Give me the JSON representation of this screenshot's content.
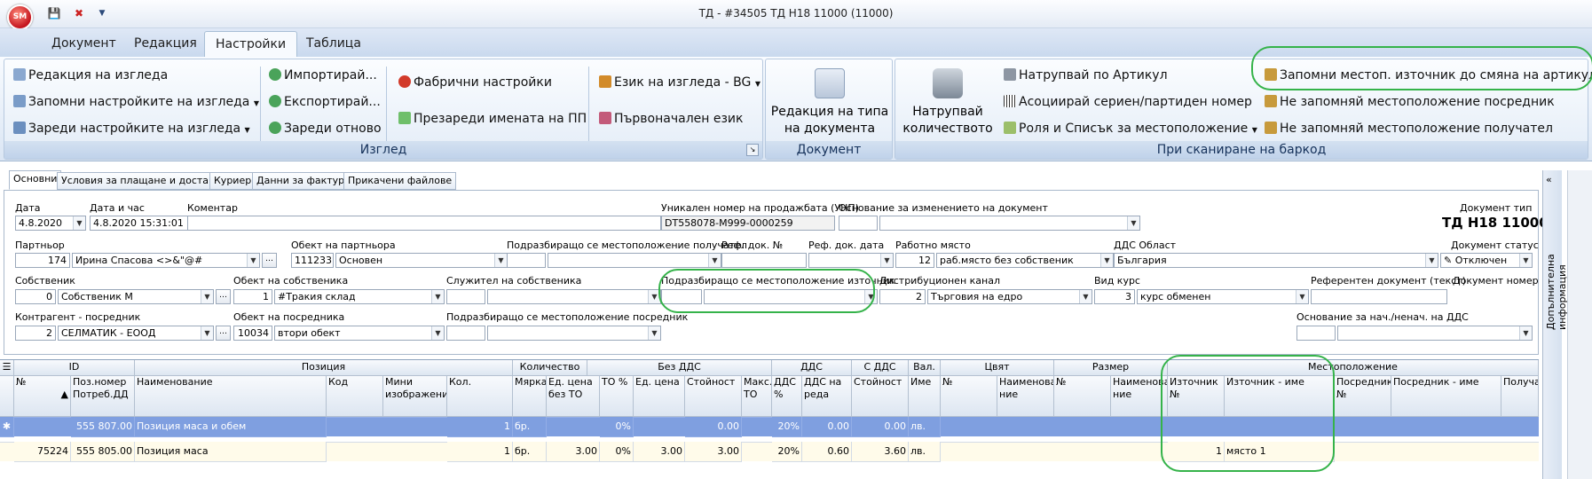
{
  "app": {
    "title": "ТД - #34505 ТД Н18 11000 (11000)",
    "logo": "SM"
  },
  "ribbon": {
    "tabs": [
      "Документ",
      "Редакция",
      "Настройки",
      "Таблица"
    ],
    "active_tab": 2,
    "view": {
      "caption": "Изглед",
      "b1": "Редакция на изгледа",
      "b2": "Запомни настройките на изгледа",
      "b3": "Зареди настройките на изгледа",
      "b4": "Импортирай...",
      "b5": "Експортирай...",
      "b6": "Зареди отново",
      "b7": "Фабрични настройки",
      "b8": "Презареди имената на ПП",
      "b9": "Език на изгледа - BG",
      "b10": "Първоначален език"
    },
    "doc": {
      "caption": "Документ",
      "l1": "Редакция на типа",
      "l2": "на документа"
    },
    "scan": {
      "caption": "При сканиране на баркод",
      "big1": "Натрупвай",
      "big2": "количеството",
      "b1": "Натрупвай по Артикул",
      "b2": "Асоциирай сериен/партиден номер",
      "b3": "Роля и Списък за местоположение",
      "b4": "Запомни местоп. източник до смяна на артикул",
      "b5": "Не запомняй местоположение посредник",
      "b6": "Не запомняй местоположение получател"
    }
  },
  "formtabs": [
    "Основни",
    "Условия за плащане и доставка",
    "Куриер",
    "Данни за фактура",
    "Прикачени файлове"
  ],
  "form": {
    "date_lbl": "Дата",
    "date": "4.8.2020",
    "datetime_lbl": "Дата и час",
    "datetime": "4.8.2020 15:31:01",
    "comment_lbl": "Коментар",
    "unp_lbl": "Уникален номер на продажбата (УНП)",
    "unp": "DT558078-M999-0000259",
    "reason_lbl": "Основание за изменението на документ",
    "doctype_lbl": "Документ тип",
    "doctype": "ТД Н18 11000",
    "partner_lbl": "Партньор",
    "partner_id": "174",
    "partner": "Ирина Спасова <>&\"@#",
    "pobj_lbl": "Обект на партньора",
    "pobj_id": "111233",
    "pobj": "Основен",
    "recv_loc_lbl": "Подразбиращо се местоположение получател",
    "refdoc_lbl": "Реф. док. №",
    "refdate_lbl": "Реф. док. дата",
    "wp_lbl": "Работно място",
    "wp_id": "12",
    "wp": "раб.място без собственик",
    "vat_lbl": "ДДС Област",
    "vat": "България",
    "status_lbl": "Документ статус",
    "status": "Отключен",
    "owner_lbl": "Собственик",
    "owner_id": "0",
    "owner": "Собственик М",
    "oobj_lbl": "Обект на собственика",
    "oobj_id": "1",
    "oobj": "#Тракия склад",
    "emp_lbl": "Служител на собственика",
    "src_loc_lbl": "Подразбиращо се местоположение източник",
    "dist_lbl": "Дистрибуционен канал",
    "dist_id": "2",
    "dist": "Търговия на едро",
    "rate_lbl": "Вид курс",
    "rate_id": "3",
    "rate": "курс обменен",
    "reftext_lbl": "Референтен документ (текст)",
    "docnum_lbl": "Документ номер",
    "contr_lbl": "Контрагент - посредник",
    "contr_id": "2",
    "contr": "СЕЛМАТИК - ЕООД",
    "cobj_lbl": "Обект на посредника",
    "cobj_id": "10034",
    "cobj": "втори обект",
    "med_loc_lbl": "Подразбиращо се местоположение посредник",
    "vatreason_lbl": "Основание за нач./ненач. на ДДС"
  },
  "grid": {
    "groups": {
      "id": "ID",
      "pos": "Позиция",
      "qty": "Количество",
      "novat": "Без ДДС",
      "vat": "ДДС",
      "withvat": "С ДДС",
      "cur": "Вал.",
      "color": "Цвят",
      "size": "Размер",
      "loc": "Местоположение"
    },
    "cols": {
      "no": "№",
      "posno": "Поз.номер",
      "cons": "Потреб.ДД",
      "name": "Наименование",
      "code": "Код",
      "img1": "Мини",
      "img2": "изображение",
      "qty": "Кол.",
      "unit": "Мярка",
      "up1": "Ед. цена",
      "up2": "без ТО",
      "top": "ТО %",
      "price": "Ед. цена",
      "val": "Стойност",
      "max1": "Макс.",
      "max2": "ТО",
      "vatp1": "ДДС",
      "vatp2": "%",
      "vatr1": "ДДС на",
      "vatr2": "реда",
      "wv": "Стойност",
      "curn": "Име",
      "cno": "№",
      "cname1": "Наименова",
      "cname2": "ние",
      "sno": "№",
      "sname1": "Наименова",
      "sname2": "ние",
      "srcno1": "Източник",
      "srcno2": "№",
      "srcname": "Източник - име",
      "medno1": "Посредник",
      "medno2": "№",
      "medname": "Посредник - име",
      "rcv": "Получа"
    },
    "total": {
      "pos": "555 807.00",
      "name": "Позиция маса и обем",
      "qty": "1",
      "unit": "бр.",
      "top": "0%",
      "val": "0.00",
      "vatp": "20%",
      "vatr": "0.00",
      "wv": "0.00",
      "cur": "лв."
    },
    "row": {
      "id": "75224",
      "pos": "555 805.00",
      "name": "Позиция маса",
      "qty": "1",
      "unit": "бр.",
      "up": "3.00",
      "top": "0%",
      "price": "3.00",
      "val": "3.00",
      "vatp": "20%",
      "vatr": "0.60",
      "wv": "3.60",
      "cur": "лв.",
      "srcno": "1",
      "srcname": "място 1"
    }
  },
  "side": {
    "info": "Допълнителна информация"
  }
}
